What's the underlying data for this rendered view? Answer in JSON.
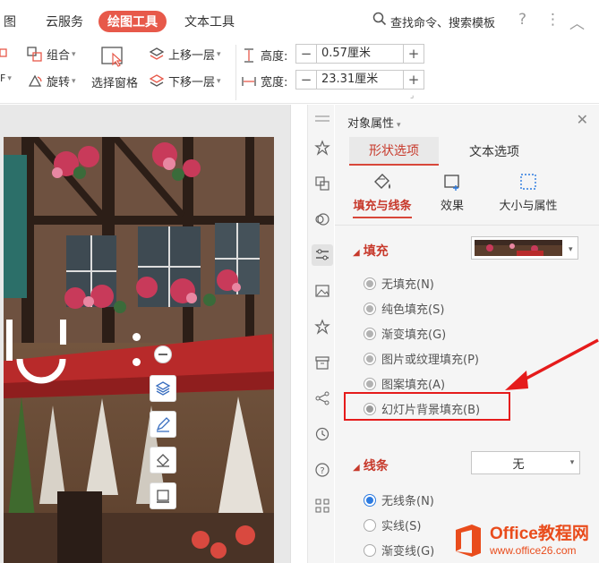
{
  "menu": {
    "items": [
      "图",
      "云服务",
      "绘图工具",
      "文本工具"
    ],
    "active_index": 2,
    "search_text": "查找命令、搜索模板",
    "help_icon": "?",
    "more_icon": "⋮",
    "collapse_icon": "︿"
  },
  "ribbon": {
    "group_label": "组合",
    "rotate_label": "旋转",
    "select_pane_label": "选择窗格",
    "bring_forward_label": "上移一层",
    "send_backward_label": "下移一层",
    "height_label": "高度:",
    "width_label": "宽度:",
    "height_value": "0.57厘米",
    "width_value": "23.31厘米",
    "minus": "−",
    "plus": "+"
  },
  "panel": {
    "title": "对象属性",
    "tabs": [
      "形状选项",
      "文本选项"
    ],
    "active_tab": 0,
    "subtabs": [
      "填充与线条",
      "效果",
      "大小与属性"
    ],
    "active_subtab": 0,
    "fill_section": {
      "title": "填充",
      "options": [
        "无填充(N)",
        "纯色填充(S)",
        "渐变填充(G)",
        "图片或纹理填充(P)",
        "图案填充(A)",
        "幻灯片背景填充(B)"
      ],
      "selected_index": 5
    },
    "line_section": {
      "title": "线条",
      "dropdown_value": "无",
      "options": [
        "无线条(N)",
        "实线(S)",
        "渐变线(G)"
      ],
      "selected_index": 0
    }
  },
  "watermark": {
    "title": "Office教程网",
    "url": "www.office26.com"
  },
  "colors": {
    "accent": "#e7594a",
    "accent_text": "#c7392b",
    "highlight": "#e51b1b",
    "radio_on": "#2d7be0"
  }
}
